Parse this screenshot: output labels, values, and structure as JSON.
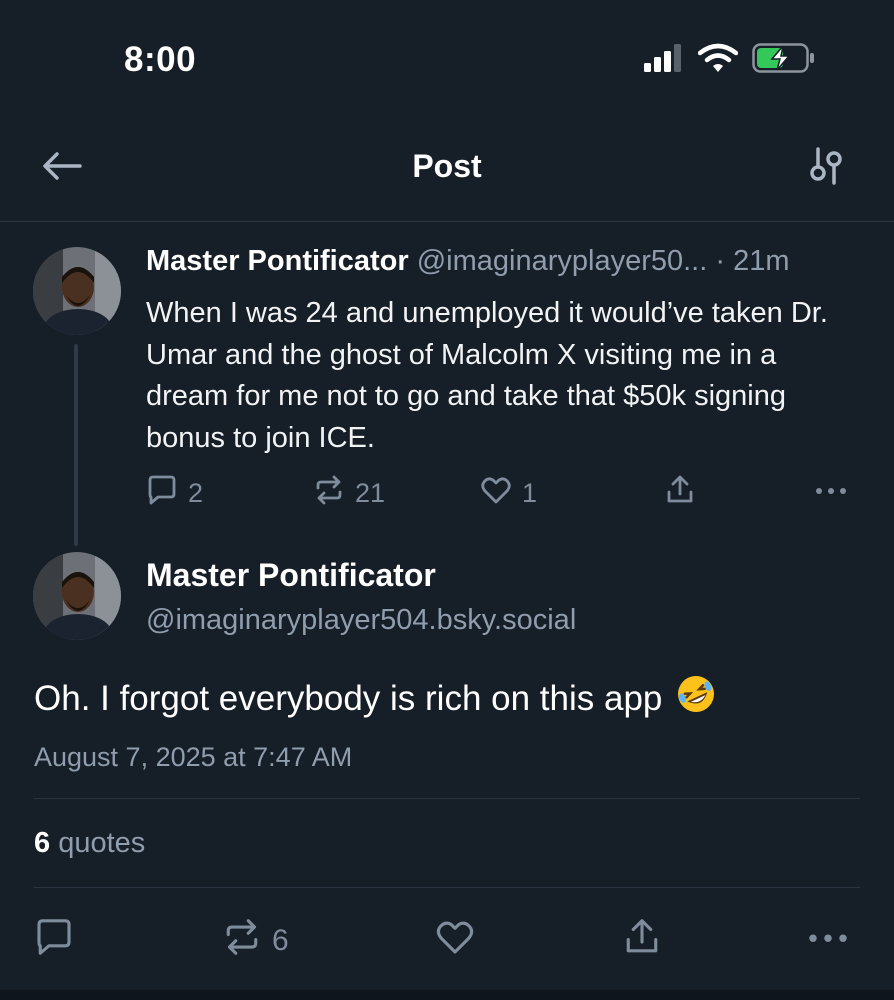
{
  "status_bar": {
    "time": "8:00",
    "icons": [
      "cellular-signal-icon",
      "wifi-icon",
      "battery-charging-icon"
    ]
  },
  "header": {
    "title": "Post",
    "back_icon": "arrow-left-icon",
    "settings_icon": "sliders-icon"
  },
  "parent_post": {
    "author_name": "Master Pontificator",
    "author_handle": "@imaginaryplayer50...",
    "separator": "·",
    "time_ago": "21m",
    "text": "When I was 24 and unemployed it would’ve taken Dr. Umar and the ghost of Malcolm X visiting me in a dream for me not to go and take that $50k signing bonus to join ICE.",
    "actions": {
      "reply_count": "2",
      "repost_count": "21",
      "like_count": "1"
    }
  },
  "main_post": {
    "author_name": "Master Pontificator",
    "author_handle": "@imaginaryplayer504.bsky.social",
    "text": "Oh. I forgot everybody is rich on this app",
    "emoji": "🤣",
    "date": "August 7, 2025 at 7:47 AM",
    "quotes_count": "6",
    "quotes_label": "quotes",
    "actions": {
      "repost_count": "6"
    }
  },
  "colors": {
    "background": "#161e27",
    "text": "#f1f3f5",
    "muted": "#8f9dad",
    "icon": "#7f8c9c",
    "divider": "#2b3542",
    "battery_green": "#34c759"
  }
}
